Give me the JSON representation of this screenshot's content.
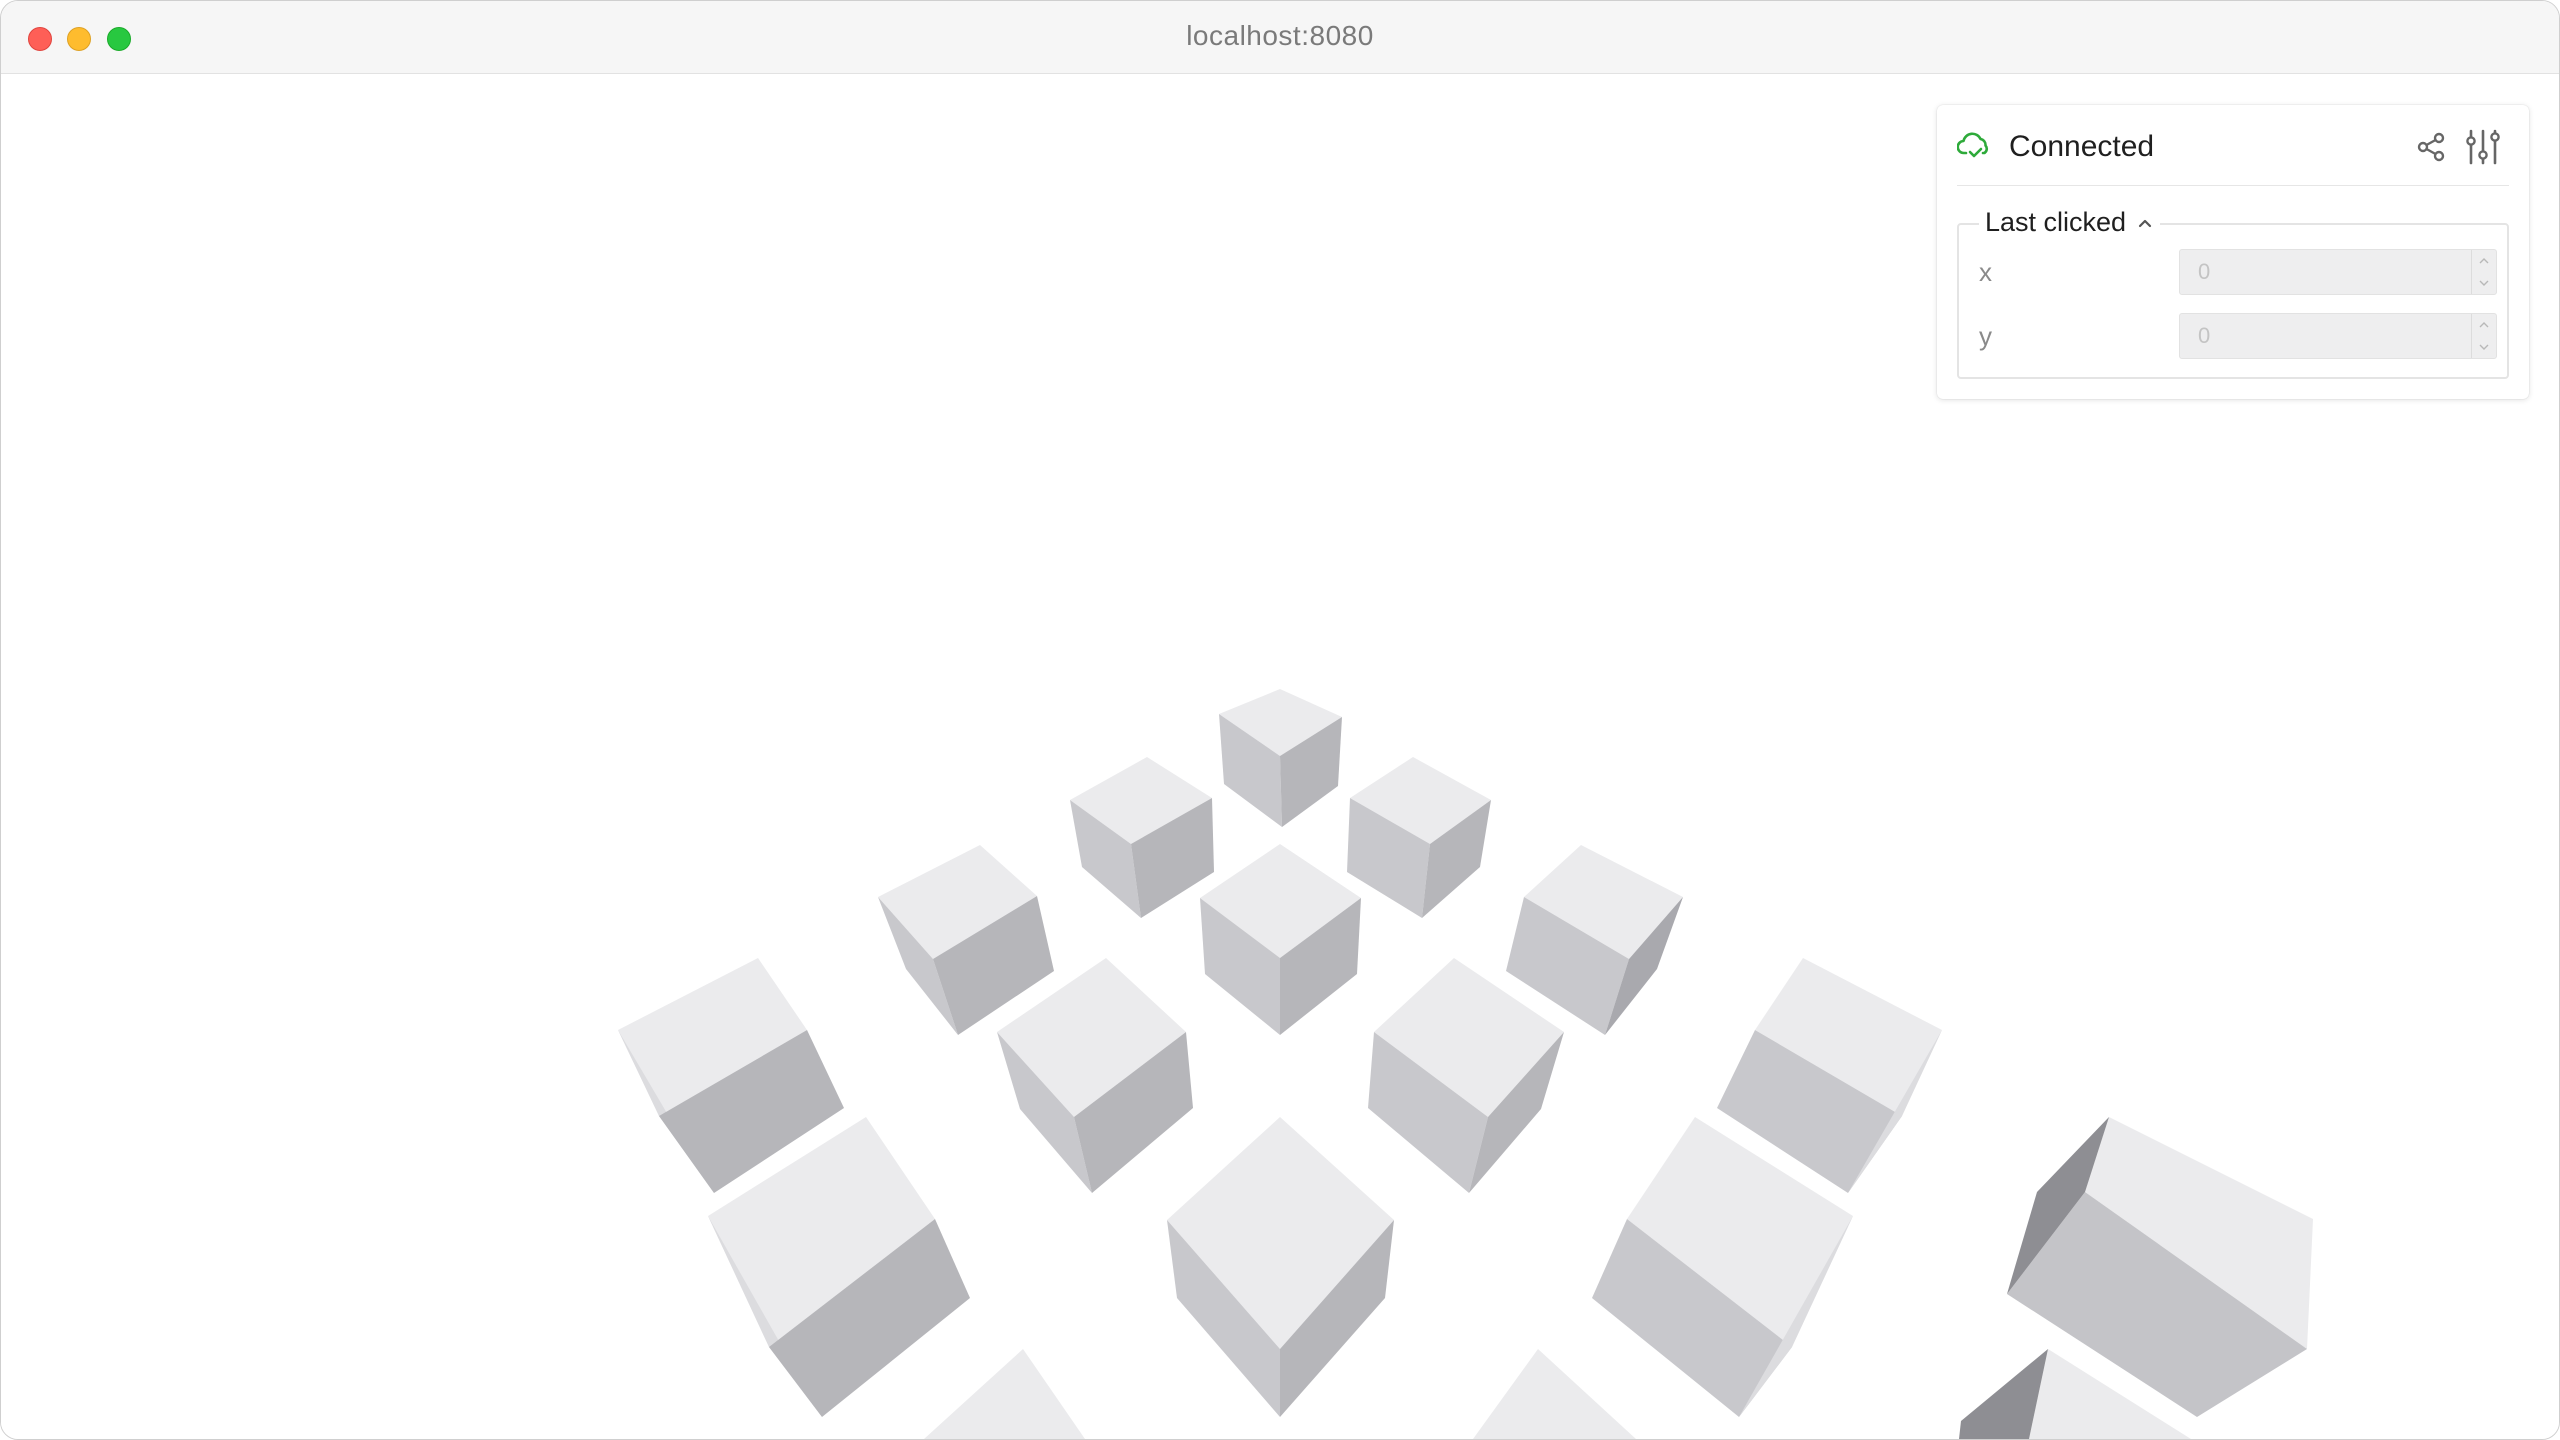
{
  "browser": {
    "url": "localhost:8080"
  },
  "panel": {
    "status": "Connected",
    "status_color": "#2eaa3a",
    "status_icon": "cloud-check-icon",
    "share_icon": "share-icon",
    "settings_icon": "sliders-icon",
    "folder": {
      "label": "Last clicked",
      "expanded": true,
      "fields": [
        {
          "label": "x",
          "value": "0"
        },
        {
          "label": "y",
          "value": "0"
        }
      ]
    }
  },
  "scene": {
    "object_count": 19,
    "object_type": "cubes"
  }
}
